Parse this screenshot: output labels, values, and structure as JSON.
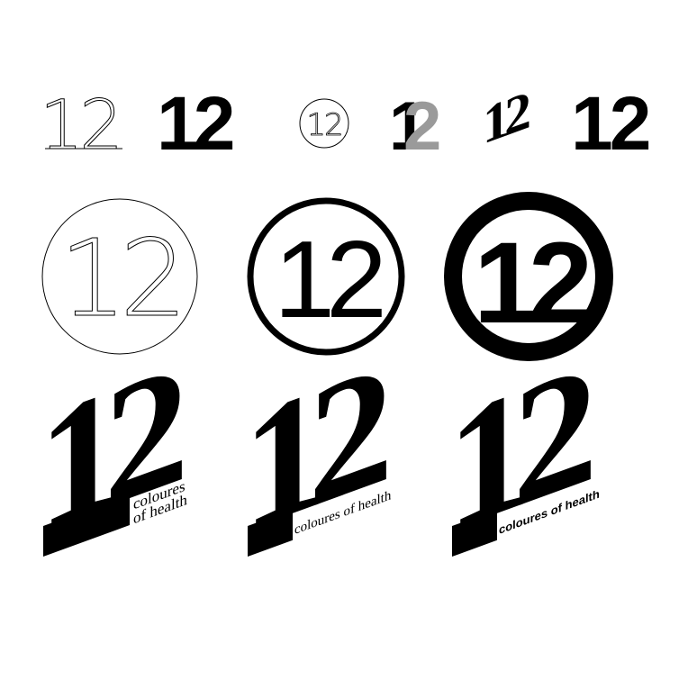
{
  "logo_text": "12",
  "tagline": {
    "line1": "coloures",
    "line2": "of health",
    "full": "coloures of health"
  },
  "colors": {
    "ink": "#000000",
    "accent_gray": "#9a9a9a",
    "background": "#ffffff"
  }
}
